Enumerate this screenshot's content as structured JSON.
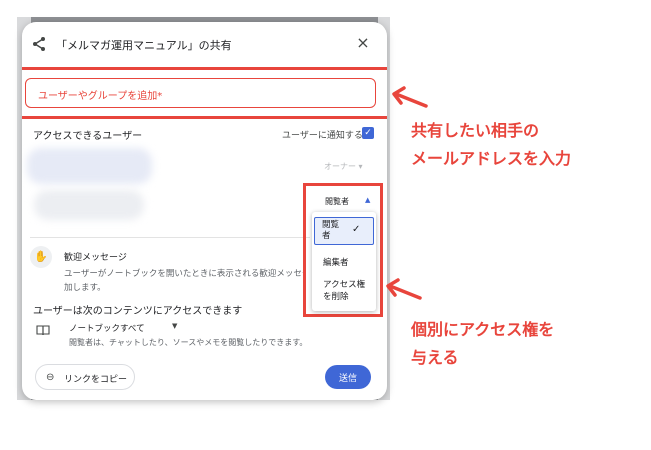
{
  "dialog": {
    "title": "「メルマガ運用マニュアル」の共有",
    "close_icon": "×"
  },
  "share_input": {
    "placeholder": "ユーザーやグループを追加*"
  },
  "users_section": {
    "heading": "アクセスできるユーザー",
    "notify_label": "ユーザーに通知する",
    "notify_checked": true,
    "owner_role": "オーナー ▾",
    "viewer_role": "閲覧者"
  },
  "role_dropdown": {
    "options": [
      {
        "label": "閲覧者",
        "selected": true
      },
      {
        "label": "編集者",
        "selected": false
      },
      {
        "label": "アクセス権を削除",
        "selected": false
      }
    ]
  },
  "welcome": {
    "title": "歓迎メッセージ",
    "desc_line1": "ユーザーがノートブックを開いたときに表示される歓迎メッセージを追",
    "desc_line2": "加します。"
  },
  "content_access": {
    "heading": "ユーザーは次のコンテンツにアクセスできます",
    "scope": "ノートブックすべて",
    "desc": "閲覧者は、チャットしたり、ソースやメモを閲覧したりできます。"
  },
  "footer": {
    "copy_link": "リンクをコピー",
    "send": "送信"
  },
  "annotations": {
    "email_note_line1": "共有したい相手の",
    "email_note_line2": "メールアドレスを入力",
    "access_note_line1": "個別にアクセス権を",
    "access_note_line2": "与える",
    "color": "#e8453c"
  }
}
